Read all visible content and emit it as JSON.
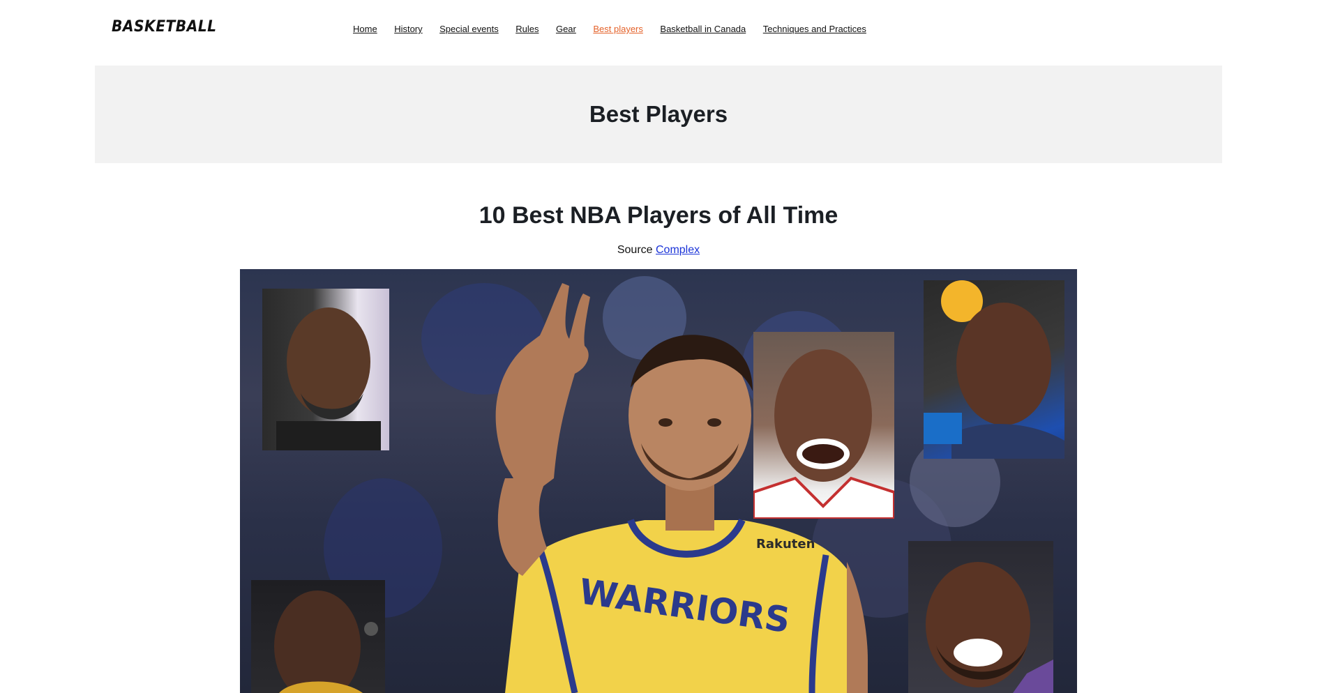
{
  "site": {
    "logo": "BASKETBALL"
  },
  "nav": {
    "items": [
      {
        "label": "Home"
      },
      {
        "label": "History"
      },
      {
        "label": "Special events"
      },
      {
        "label": "Rules"
      },
      {
        "label": "Gear"
      },
      {
        "label": "Best players",
        "active": true
      },
      {
        "label": "Basketball in Canada"
      },
      {
        "label": "Techniques and Practices"
      }
    ],
    "active_color": "#e4622a"
  },
  "hero": {
    "title": "Best Players"
  },
  "article": {
    "heading": "10 Best NBA Players of All Time",
    "source_label": "Source",
    "source_link": "Complex"
  },
  "collage": {
    "photos": [
      "player-portrait-1-icon",
      "player-portrait-2-icon",
      "player-portrait-3-icon",
      "player-portrait-4-icon",
      "player-portrait-5-icon",
      "player-portrait-6-icon"
    ],
    "main_player_jersey_text": "WARRIORS",
    "main_player_sponsor": "Rakuten"
  }
}
